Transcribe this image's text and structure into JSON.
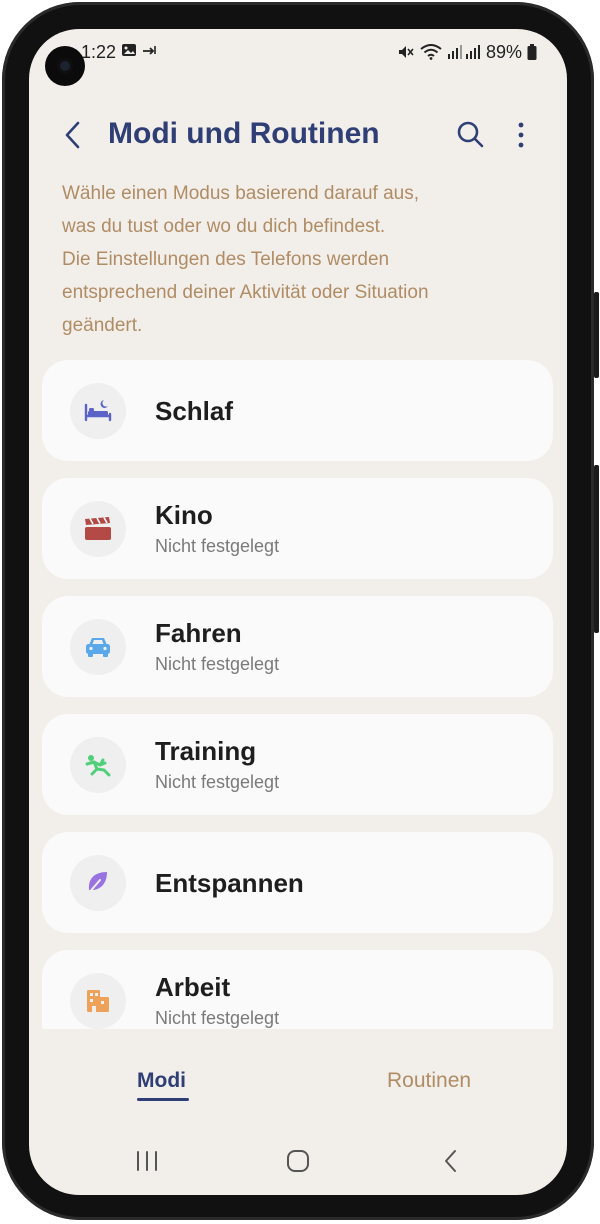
{
  "status_bar": {
    "time": "1:22",
    "icons_left": [
      "image-icon",
      "data-transfer-icon"
    ],
    "battery_text": "89%",
    "icons_right": [
      "mute-icon",
      "wifi-icon",
      "signal-icon",
      "battery-icon"
    ]
  },
  "header": {
    "title": "Modi und Routinen"
  },
  "description": [
    "Wähle einen Modus basierend darauf aus,",
    "was du tust oder wo du dich befindest.",
    "Die Einstellungen des Telefons werden",
    "entsprechend deiner Aktivität oder Situation",
    "geändert."
  ],
  "modes": [
    {
      "name": "Schlaf",
      "status": "",
      "icon": "bed-icon",
      "color": "#5b63c9"
    },
    {
      "name": "Kino",
      "status": "Nicht festgelegt",
      "icon": "clapperboard-icon",
      "color": "#b34a45"
    },
    {
      "name": "Fahren",
      "status": "Nicht festgelegt",
      "icon": "car-icon",
      "color": "#5aa8ea"
    },
    {
      "name": "Training",
      "status": "Nicht festgelegt",
      "icon": "running-icon",
      "color": "#4fcf79"
    },
    {
      "name": "Entspannen",
      "status": "",
      "icon": "leaf-icon",
      "color": "#9a73e3"
    },
    {
      "name": "Arbeit",
      "status": "Nicht festgelegt",
      "icon": "building-icon",
      "color": "#eda159"
    }
  ],
  "tabs": {
    "modi": "Modi",
    "routinen": "Routinen"
  },
  "colors": {
    "accent": "#2f3e75",
    "description": "#b08c65",
    "background": "#f2efea"
  }
}
